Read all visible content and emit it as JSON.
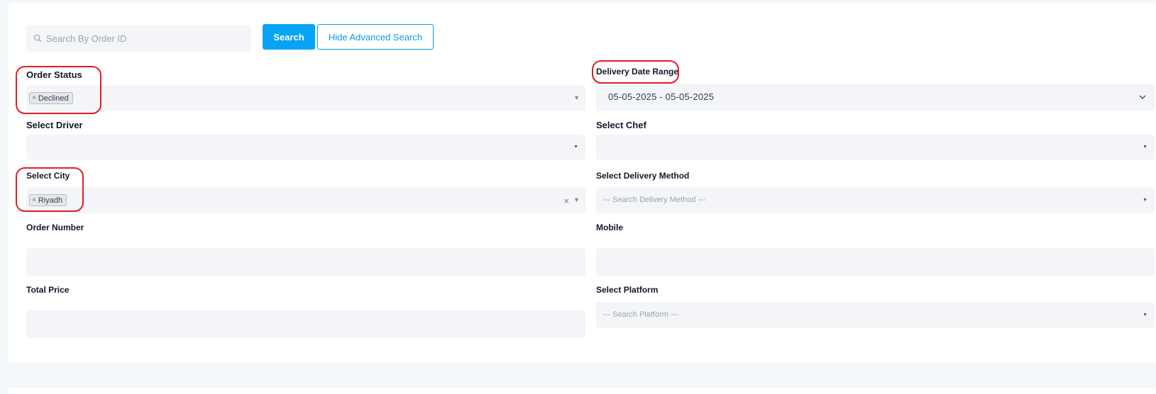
{
  "search": {
    "placeholder": "Search By Order ID",
    "value": ""
  },
  "buttons": {
    "search_label": "Search",
    "hide_advanced_label": "Hide Advanced Search"
  },
  "filters": {
    "order_status": {
      "label": "Order Status",
      "selected_tag": "Declined"
    },
    "delivery_date_range": {
      "label": "Delivery Date Range",
      "value": "05-05-2025 - 05-05-2025"
    },
    "driver": {
      "label": "Select Driver"
    },
    "chef": {
      "label": "Select Chef"
    },
    "city": {
      "label": "Select City",
      "selected_tag": "Riyadh"
    },
    "delivery_method": {
      "label": "Select Delivery Method",
      "placeholder": "--- Search Delivery Method ---"
    },
    "order_number": {
      "label": "Order Number",
      "value": ""
    },
    "mobile": {
      "label": "Mobile",
      "value": ""
    },
    "total_price": {
      "label": "Total Price",
      "value": ""
    },
    "platform": {
      "label": "Select Platform",
      "placeholder": "--- Search Platform ---"
    }
  },
  "icons": {
    "tag_remove": "×",
    "dropdown_caret": "▼",
    "clear": "×"
  },
  "colors": {
    "primary": "#08a3f5",
    "field_bg": "#f3f5f8",
    "highlight": "#e11d24"
  }
}
